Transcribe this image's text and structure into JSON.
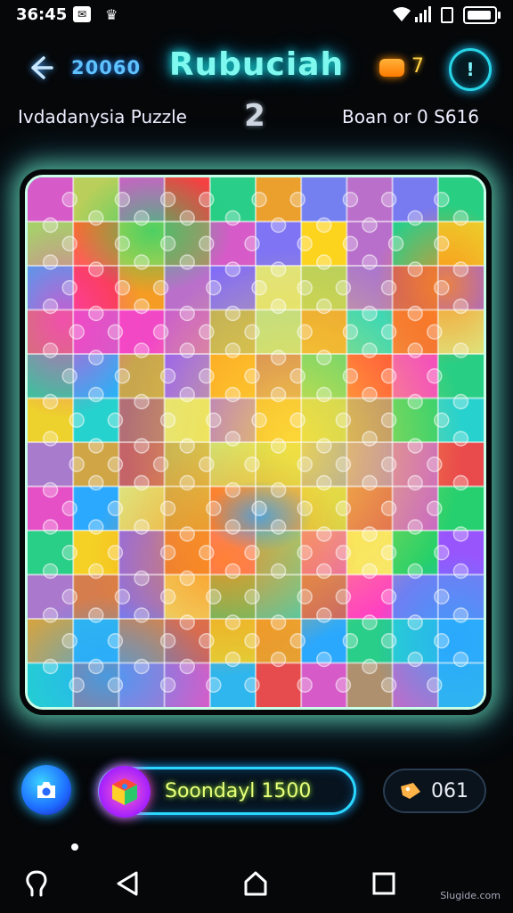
{
  "status_bar": {
    "time": "36:45"
  },
  "header": {
    "score": "20060",
    "title": "Rubuciah",
    "coins": "7",
    "info_symbol": "!"
  },
  "subheader": {
    "puzzle_name": "Ivdadanysia Puzzle",
    "level": "2",
    "board_info": "Boan or 0 S616"
  },
  "bottom_bar": {
    "hint_label": "Soondayl 1500",
    "moves_value": "061"
  },
  "watermark": "Slugide.com",
  "colors": {
    "accent_cyan": "#2ad8ff",
    "title_glow": "#7ff8ef",
    "hint_text": "#e8ff7a",
    "coin": "#ff8a00"
  },
  "icons": {
    "back": "arrow-left-icon",
    "coin": "coin-icon",
    "info": "info-icon",
    "camera": "camera-icon",
    "hint_cube": "cube-icon",
    "moves": "tag-icon"
  }
}
